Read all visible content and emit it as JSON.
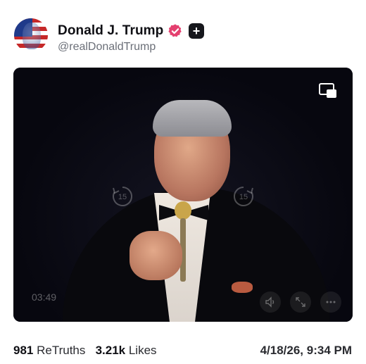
{
  "post": {
    "author_name": "Donald J. Trump",
    "author_handle": "@realDonaldTrump"
  },
  "video": {
    "duration": "03:49",
    "skip_back_label": "15",
    "skip_forward_label": "15"
  },
  "stats": {
    "retruths_count": "981",
    "retruths_label": "ReTruths",
    "likes_count": "3.21k",
    "likes_label": "Likes",
    "timestamp": "4/18/26, 9:34 PM"
  },
  "colors": {
    "verified_badge": "#e4406f",
    "plus_badge": "#16171c",
    "handle_text": "#6b6f78",
    "video_bg": "#0a0a16"
  },
  "icons": {
    "verified": "verified-badge-icon",
    "plus": "plus-icon",
    "pip": "picture-in-picture-icon",
    "volume": "volume-icon",
    "fullscreen": "expand-icon",
    "more": "more-dots-icon"
  }
}
